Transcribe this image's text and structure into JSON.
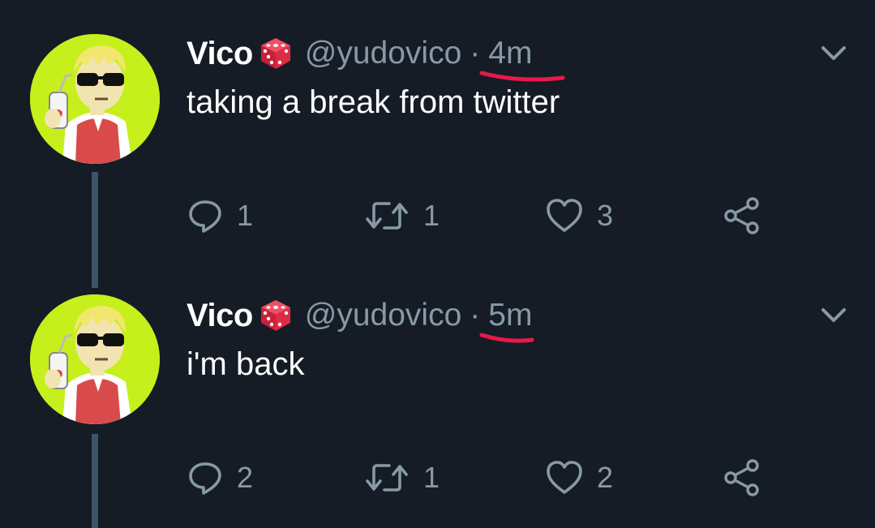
{
  "tweets": [
    {
      "display_name": "Vico",
      "handle": "@yudovico",
      "separator": "·",
      "time": "4m",
      "text": "taking a break from twitter",
      "replies": "1",
      "retweets": "1",
      "likes": "3"
    },
    {
      "display_name": "Vico",
      "handle": "@yudovico",
      "separator": "·",
      "time": "5m",
      "text": "i'm back",
      "replies": "2",
      "retweets": "1",
      "likes": "2"
    }
  ],
  "icons": {
    "name_emoji": "game-die-icon",
    "reply": "reply-icon",
    "retweet": "retweet-icon",
    "like": "heart-icon",
    "share": "share-icon",
    "menu": "chevron-down-icon"
  },
  "colors": {
    "background": "#151c25",
    "secondary_text": "#8899a6",
    "thread_line": "#3d5466",
    "annotation_underline": "#e8194b",
    "avatar_background": "#c6ef1c"
  }
}
